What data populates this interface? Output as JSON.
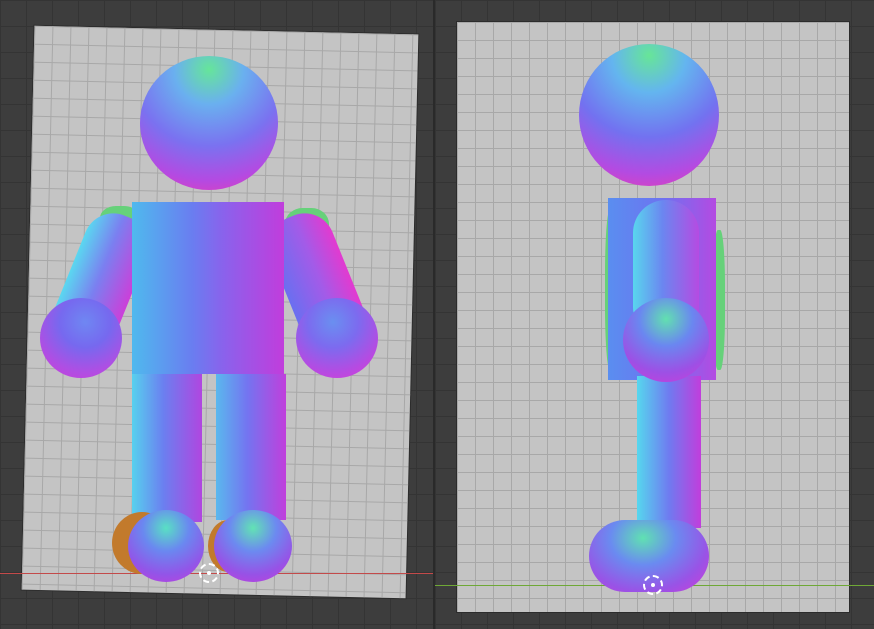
{
  "app": {
    "editor": "3D Viewport",
    "views": [
      {
        "name": "front",
        "reference_image": "character-front"
      },
      {
        "name": "side",
        "reference_image": "character-side"
      }
    ]
  },
  "colors": {
    "viewport_bg": "#3d3d3d",
    "reference_bg": "#c4c4c4",
    "axis_x": "#c34a4a",
    "axis_y": "#6fa836",
    "normal_blue": "#6b6cf0",
    "normal_magenta": "#d42fd8",
    "normal_cyan": "#57d9e8",
    "normal_green": "#5de27c",
    "shadow_orange": "#c27a2c"
  },
  "icons": {
    "cursor": "3d-cursor-icon"
  }
}
